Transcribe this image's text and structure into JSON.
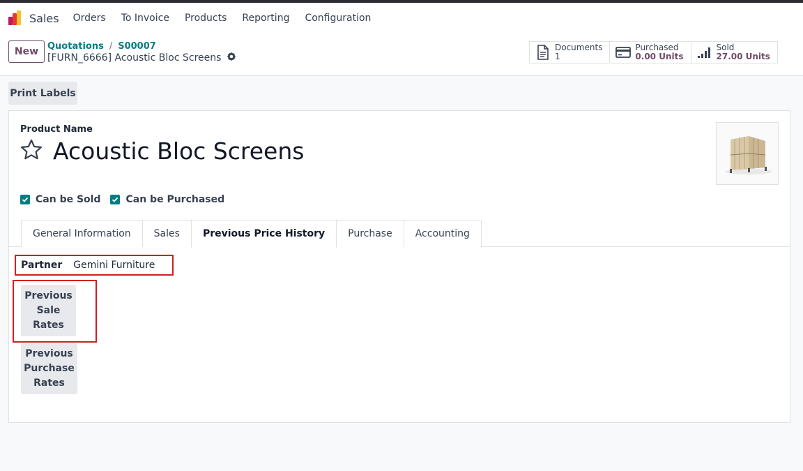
{
  "navbar": {
    "app_name": "Sales",
    "menu": [
      "Orders",
      "To Invoice",
      "Products",
      "Reporting",
      "Configuration"
    ]
  },
  "control": {
    "new_label": "New",
    "breadcrumb": [
      "Quotations",
      "S00007"
    ],
    "record_title": "[FURN_6666] Acoustic Bloc Screens"
  },
  "stats": {
    "documents": {
      "title": "Documents",
      "value": "1",
      "icon": "document-icon"
    },
    "purchased": {
      "title": "Purchased",
      "value": "0.00 Units",
      "icon": "credit-card-icon"
    },
    "sold": {
      "title": "Sold",
      "value": "27.00 Units",
      "icon": "signal-bars-icon"
    }
  },
  "actions": {
    "print_labels": "Print Labels"
  },
  "form": {
    "product_name_label": "Product Name",
    "product_name": "Acoustic Bloc Screens",
    "can_be_sold": "Can be Sold",
    "can_be_purchased": "Can be Purchased",
    "tabs": [
      "General Information",
      "Sales",
      "Previous Price History",
      "Purchase",
      "Accounting"
    ],
    "active_tab": "Previous Price History",
    "partner_label": "Partner",
    "partner_value": "Gemini Furniture",
    "prev_sale_lines": [
      "Previous",
      "Sale",
      "Rates"
    ],
    "prev_purchase_lines": [
      "Previous",
      "Purchase",
      "Rates"
    ]
  },
  "colors": {
    "brand": "#714b67",
    "accent": "#017e84",
    "highlight": "#d11f1f"
  }
}
